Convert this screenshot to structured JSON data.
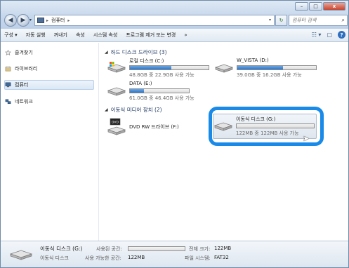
{
  "window": {
    "buttons": {
      "minimize": "–",
      "maximize": "□",
      "close": "x"
    }
  },
  "address": {
    "segments": [
      "컴퓨터"
    ],
    "separator": "▸",
    "search_placeholder": "컴퓨터 검색"
  },
  "toolbar": {
    "items": [
      "구성 ▾",
      "자동 실행",
      "꺼내기",
      "속성",
      "시스템 속성",
      "프로그램 제거 또는 변경",
      "»"
    ]
  },
  "nav": {
    "items": [
      {
        "label": "즐겨찾기",
        "icon": "star-icon"
      },
      {
        "label": "라이브러리",
        "icon": "library-icon"
      },
      {
        "label": "컴퓨터",
        "icon": "computer-icon"
      },
      {
        "label": "네트워크",
        "icon": "network-icon"
      }
    ]
  },
  "groups": {
    "hard_drives": "하드 디스크 드라이브 (3)",
    "removable": "이동식 미디어 장치 (2)"
  },
  "drives": [
    {
      "name": "로컬 디스크 (C:)",
      "space": "48.8GB 중 22.9GB 사용 가능",
      "used_fraction": 0.53
    },
    {
      "name": "W_VISTA (D:)",
      "space": "39.0GB 중 16.2GB 사용 가능",
      "used_fraction": 0.58
    },
    {
      "name": "DATA (E:)",
      "space": "61.0GB 중 46.4GB 사용 가능",
      "used_fraction": 0.24
    },
    {
      "name": "DVD RW 드라이브 (F:)"
    },
    {
      "name": "이동식 디스크 (G:)",
      "space": "122MB 중 122MB 사용 가능",
      "used_fraction": 0.0
    }
  ],
  "details": {
    "name": "이동식 디스크 (G:)",
    "type": "이동식 디스크",
    "used_label": "사용된 공간:",
    "free_label": "사용 가능한 공간:",
    "free_value": "122MB",
    "total_label": "전체 크기:",
    "total_value": "122MB",
    "fs_label": "파일 시스템:",
    "fs_value": "FAT32"
  },
  "colors": {
    "accent": "#1a8ae8",
    "bar_fill": "#2e75c7"
  }
}
